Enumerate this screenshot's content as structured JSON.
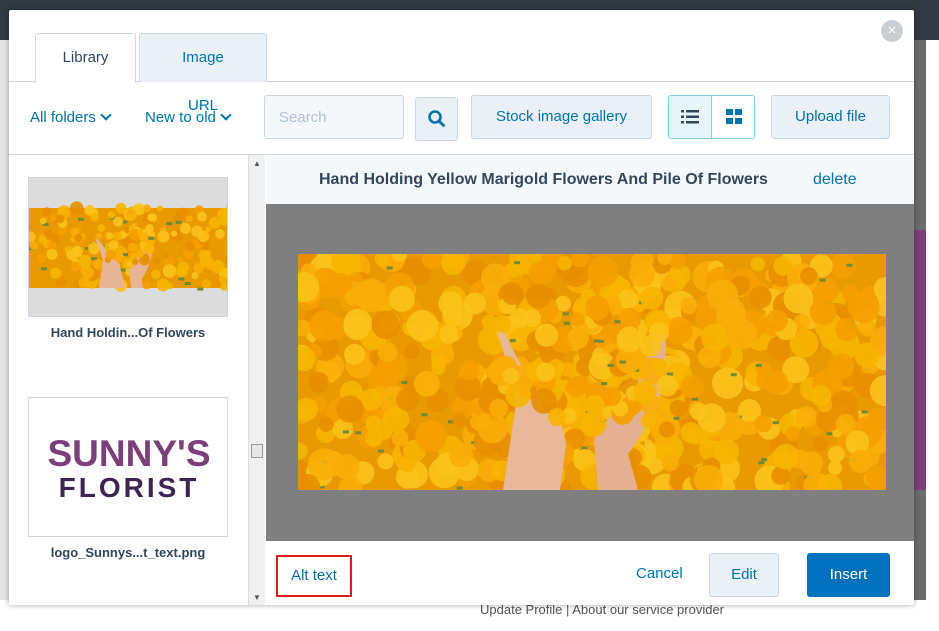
{
  "dialog": {
    "tabs": [
      {
        "label": "Library",
        "active": true
      },
      {
        "label": "Image URL",
        "active": false
      }
    ],
    "close_icon": "close-icon"
  },
  "toolbar": {
    "folder_filter": "All folders",
    "sort_order": "New to old",
    "search": {
      "placeholder": "Search",
      "value": ""
    },
    "stock_gallery_label": "Stock image gallery",
    "upload_label": "Upload file",
    "view_mode": "list"
  },
  "library": {
    "items": [
      {
        "name": "Hand Holdin...Of Flowers",
        "selected": true
      },
      {
        "name": "logo_Sunnys...t_text.png",
        "selected": false,
        "logo_line1": "SUNNY'S",
        "logo_line2": "FLORIST"
      }
    ]
  },
  "detail": {
    "title": "Hand Holding Yellow Marigold Flowers And Pile Of Flowers",
    "delete_label": "delete"
  },
  "footer": {
    "alt_text_label": "Alt text",
    "cancel_label": "Cancel",
    "edit_label": "Edit",
    "insert_label": "Insert"
  },
  "background": {
    "footer_text": "Update Profile | About our service provider"
  },
  "colors": {
    "accent": "#0073ae",
    "primary_button": "#0071bc",
    "highlight_box": "#e01b1b",
    "marigold": "#f5a800",
    "logo_purple": "#7b3f7a"
  }
}
